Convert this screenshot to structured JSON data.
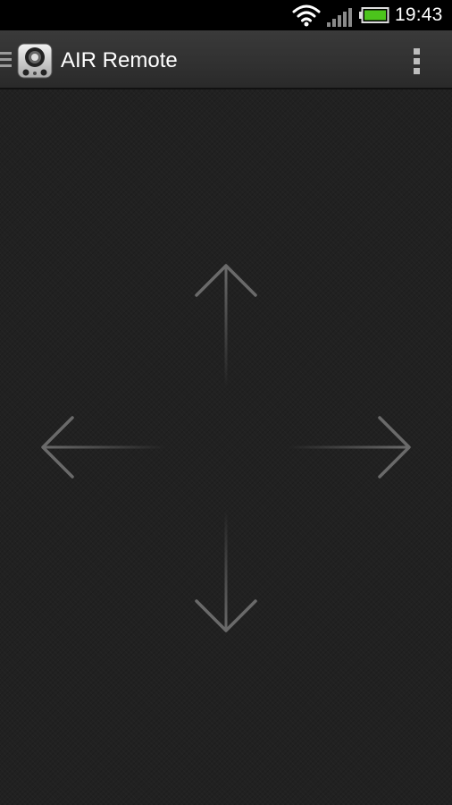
{
  "status_bar": {
    "time": "19:43",
    "icons": [
      "wifi-icon",
      "signal-icon",
      "battery-icon"
    ],
    "battery_color": "#4cc41c"
  },
  "action_bar": {
    "title": "AIR Remote",
    "app_icon": "speaker-app-icon",
    "overflow_icon": "overflow-menu-icon",
    "drawer_icon": "drawer-icon"
  },
  "touchpad": {
    "arrows": [
      "up-arrow-icon",
      "left-arrow-icon",
      "right-arrow-icon",
      "down-arrow-icon"
    ],
    "arrow_color": "#6a6a6a"
  }
}
